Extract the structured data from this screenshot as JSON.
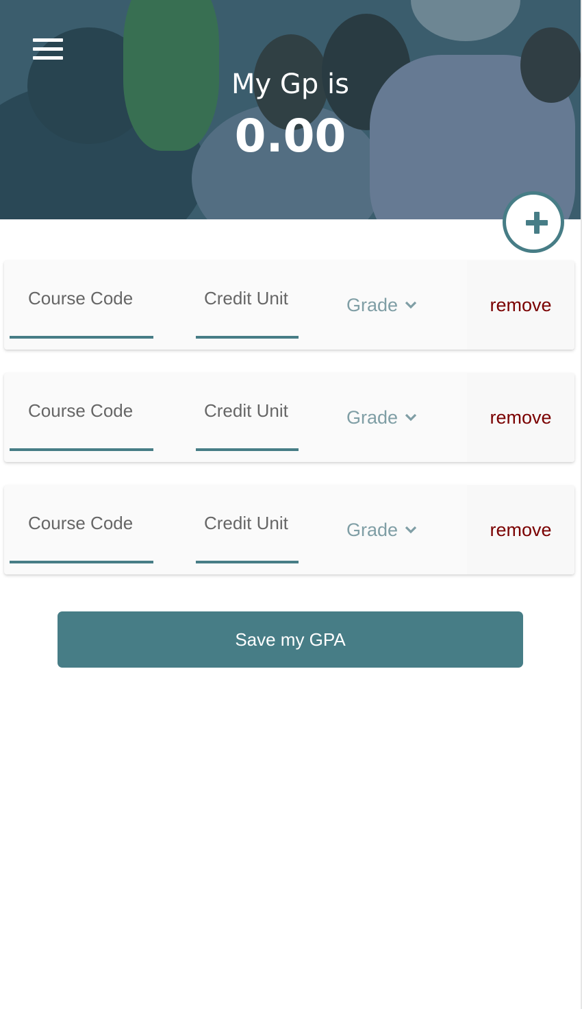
{
  "header": {
    "title": "My Gp is",
    "gp_value": "0.00",
    "menu_icon": "hamburger-menu-icon"
  },
  "add_button": {
    "icon": "plus-icon"
  },
  "courses": [
    {
      "course_placeholder": "Course Code",
      "credit_placeholder": "Credit Unit",
      "grade_label": "Grade",
      "remove_label": "remove"
    },
    {
      "course_placeholder": "Course Code",
      "credit_placeholder": "Credit Unit",
      "grade_label": "Grade",
      "remove_label": "remove"
    },
    {
      "course_placeholder": "Course Code",
      "credit_placeholder": "Credit Unit",
      "grade_label": "Grade",
      "remove_label": "remove"
    }
  ],
  "save_button": {
    "label": "Save my GPA"
  },
  "colors": {
    "accent": "#477d86",
    "remove_text": "#7a0000",
    "grade_text": "#7f9ea5"
  }
}
